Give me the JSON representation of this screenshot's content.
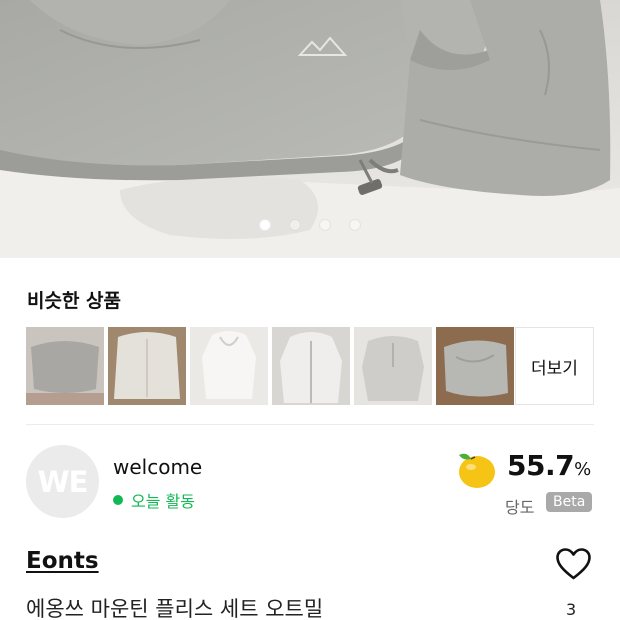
{
  "hero": {
    "image": "gray-fleece-mountain-set-photo",
    "page_indicator": {
      "total": 4,
      "active": 1
    }
  },
  "similar": {
    "title": "비슷한 상품",
    "thumbnails": [
      "similar-item-1",
      "similar-item-2",
      "similar-item-3",
      "similar-item-4",
      "similar-item-5",
      "similar-item-6"
    ],
    "more_label": "더보기"
  },
  "seller": {
    "avatar_initials": "WE",
    "name": "welcome",
    "activity": "오늘 활동",
    "activity_color": "#12b853",
    "sweetness_icon": "lemon-fruit-icon",
    "sweetness_value": "55.7",
    "sweetness_unit": "%",
    "sweetness_label": "당도",
    "beta_badge": "Beta"
  },
  "product": {
    "brand": "Eonts",
    "title": "에옹쓰 마운틴 플리스 세트 오트밀",
    "likes": "3",
    "like_icon": "heart-outline-icon"
  }
}
